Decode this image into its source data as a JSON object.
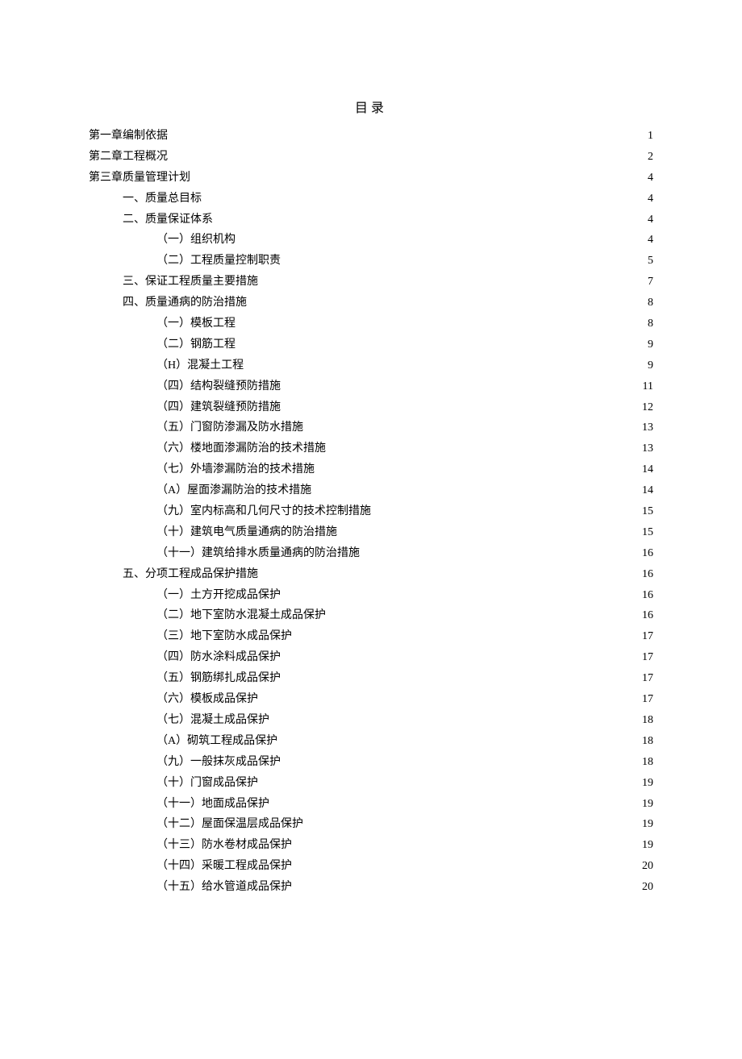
{
  "title": "目录",
  "entries": [
    {
      "indent": 0,
      "label": "第一章编制依据",
      "page": "1"
    },
    {
      "indent": 0,
      "label": "第二章工程概况",
      "page": "2"
    },
    {
      "indent": 0,
      "label": "第三章质量管理计划",
      "page": "4"
    },
    {
      "indent": 1,
      "label": "一、质量总目标",
      "page": "4"
    },
    {
      "indent": 1,
      "label": "二、质量保证体系",
      "page": "4"
    },
    {
      "indent": 2,
      "label": "（一）组织机构",
      "page": "4"
    },
    {
      "indent": 2,
      "label": "（二）工程质量控制职责",
      "page": "5"
    },
    {
      "indent": 1,
      "label": "三、保证工程质量主要措施",
      "page": "7"
    },
    {
      "indent": 1,
      "label": "四、质量通病的防治措施",
      "page": "8"
    },
    {
      "indent": 2,
      "label": "（一）模板工程",
      "page": "8"
    },
    {
      "indent": 2,
      "label": "（二）钢筋工程",
      "page": "9"
    },
    {
      "indent": 2,
      "label": "（H）混凝土工程",
      "page": "9"
    },
    {
      "indent": 2,
      "label": "（四）结构裂缝预防措施",
      "page": "11"
    },
    {
      "indent": 2,
      "label": "（四）建筑裂缝预防措施",
      "page": "12"
    },
    {
      "indent": 2,
      "label": "（五）门窗防渗漏及防水措施",
      "page": "13"
    },
    {
      "indent": 2,
      "label": "（六）楼地面渗漏防治的技术措施",
      "page": "13"
    },
    {
      "indent": 2,
      "label": "（七）外墙渗漏防治的技术措施",
      "page": "14"
    },
    {
      "indent": 2,
      "label": "（A）屋面渗漏防治的技术措施",
      "page": "14"
    },
    {
      "indent": 2,
      "label": "（九）室内标高和几何尺寸的技术控制措施",
      "page": "15"
    },
    {
      "indent": 2,
      "label": "（十）建筑电气质量通病的防治措施",
      "page": "15"
    },
    {
      "indent": 2,
      "label": "（十一）建筑给排水质量通病的防治措施",
      "page": "16"
    },
    {
      "indent": 1,
      "label": "五、分项工程成品保护措施",
      "page": "16"
    },
    {
      "indent": 2,
      "label": "（一）土方开挖成品保护",
      "page": "16"
    },
    {
      "indent": 2,
      "label": "（二）地下室防水混凝土成品保护",
      "page": "16"
    },
    {
      "indent": 2,
      "label": "（三）地下室防水成品保护",
      "page": "17"
    },
    {
      "indent": 2,
      "label": "（四）防水涂料成品保护",
      "page": "17"
    },
    {
      "indent": 2,
      "label": "（五）钢筋绑扎成品保护",
      "page": "17"
    },
    {
      "indent": 2,
      "label": "（六）模板成品保护",
      "page": "17"
    },
    {
      "indent": 2,
      "label": "（七）混凝土成品保护",
      "page": "18"
    },
    {
      "indent": 2,
      "label": "（A）砌筑工程成品保护",
      "page": "18"
    },
    {
      "indent": 2,
      "label": "（九）一般抹灰成品保护",
      "page": "18"
    },
    {
      "indent": 2,
      "label": "（十）门窗成品保护",
      "page": "19"
    },
    {
      "indent": 2,
      "label": "（十一）地面成品保护",
      "page": "19"
    },
    {
      "indent": 2,
      "label": "（十二）屋面保温层成品保护",
      "page": "19"
    },
    {
      "indent": 2,
      "label": "（十三）防水卷材成品保护",
      "page": "19"
    },
    {
      "indent": 2,
      "label": "（十四）采暖工程成品保护",
      "page": "20"
    },
    {
      "indent": 2,
      "label": "（十五）给水管道成品保护",
      "page": "20"
    }
  ]
}
